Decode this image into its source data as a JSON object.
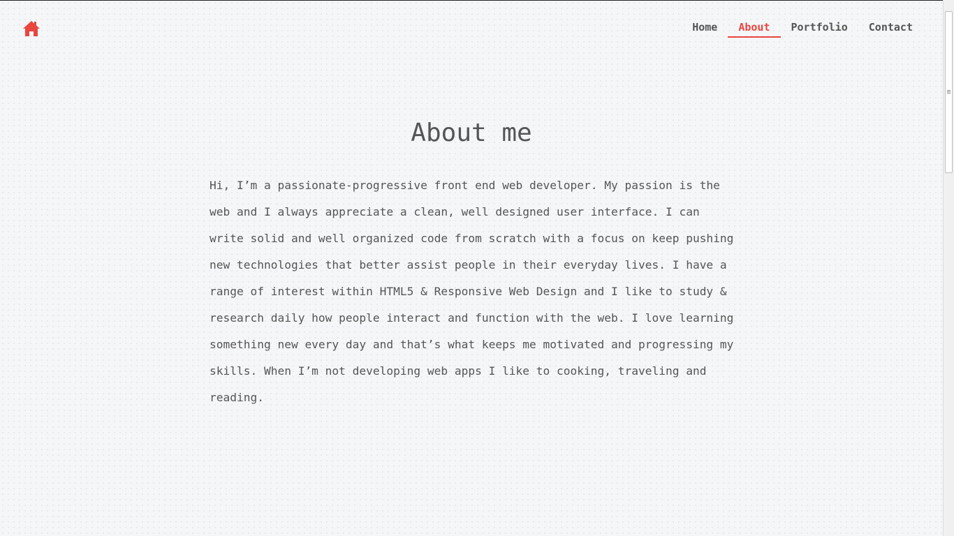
{
  "nav": {
    "home_icon": "home-icon",
    "links": [
      {
        "label": "Home"
      },
      {
        "label": "About"
      },
      {
        "label": "Portfolio"
      },
      {
        "label": "Contact"
      }
    ],
    "active": "About"
  },
  "main": {
    "title": "About me",
    "bio": "Hi, I’m a passionate-progressive front end web developer. My passion is the web and I always appreciate a clean, well designed user interface. I can write solid and well organized code from scratch with a focus on keep pushing new technologies that better assist people in their everyday lives. I have a range of interest within HTML5 & Responsive Web Design and I like to study & research daily how people interact and function with the web. I love learning something new every day and that’s what keeps me motivated and progressing my skills. When I’m not developing web apps I like to cooking, traveling and reading."
  },
  "colors": {
    "accent": "#e8463f",
    "text": "#555555",
    "background": "#f5f6f8"
  }
}
